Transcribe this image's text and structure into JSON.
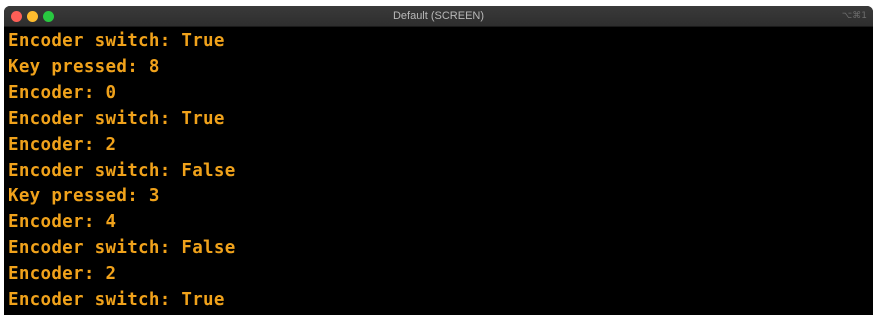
{
  "window": {
    "title": "Default (SCREEN)",
    "shortcut_hint": "⌥⌘1"
  },
  "colors": {
    "terminal_text": "#f0a21b",
    "terminal_bg": "#000000",
    "close": "#fd5f57",
    "minimize": "#febc2e",
    "zoom": "#28c840"
  },
  "terminal": {
    "lines": [
      "Encoder switch: True",
      "Key pressed: 8",
      "Encoder: 0",
      "Encoder switch: True",
      "Encoder: 2",
      "Encoder switch: False",
      "Key pressed: 3",
      "Encoder: 4",
      "Encoder switch: False",
      "Encoder: 2",
      "Encoder switch: True"
    ]
  }
}
